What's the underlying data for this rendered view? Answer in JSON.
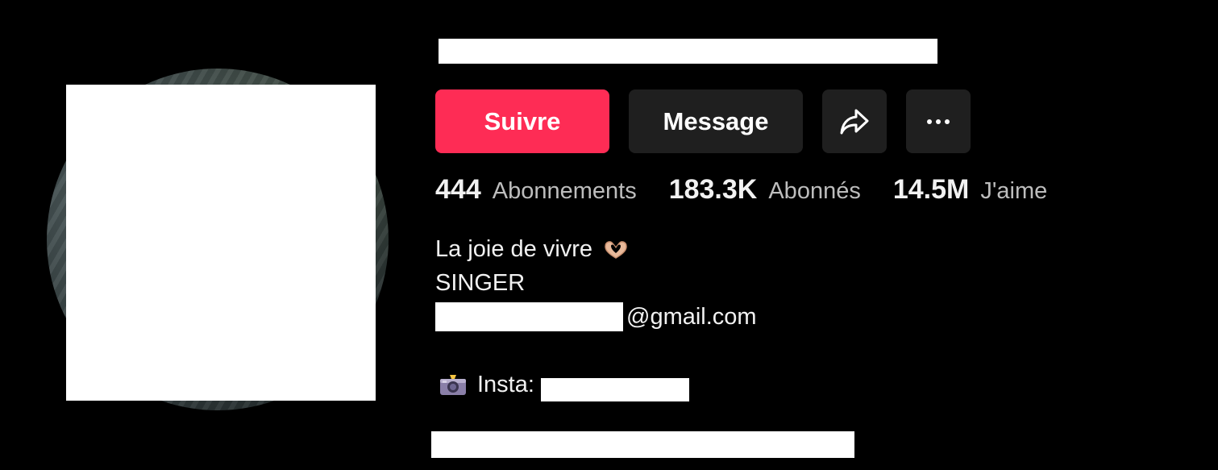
{
  "profile": {
    "actions": {
      "follow_label": "Suivre",
      "message_label": "Message",
      "share_icon": "share-icon",
      "more_icon": "more-icon"
    },
    "stats": [
      {
        "value": "444",
        "label": "Abonnements"
      },
      {
        "value": "183.3K",
        "label": "Abonnés"
      },
      {
        "value": "14.5M",
        "label": "J'aime"
      }
    ],
    "bio": {
      "line1": "La joie de vivre",
      "line1_icon": "heart-hands-icon",
      "line2": "SINGER",
      "email_suffix": "@gmail.com",
      "insta_icon": "camera-flash-icon",
      "insta_label": "Insta:"
    }
  },
  "colors": {
    "background": "#000000",
    "follow_button": "#fe2c55",
    "secondary_button": "#1f1f1f",
    "stat_label": "#bdbdbd",
    "text": "#f1f1f1"
  }
}
